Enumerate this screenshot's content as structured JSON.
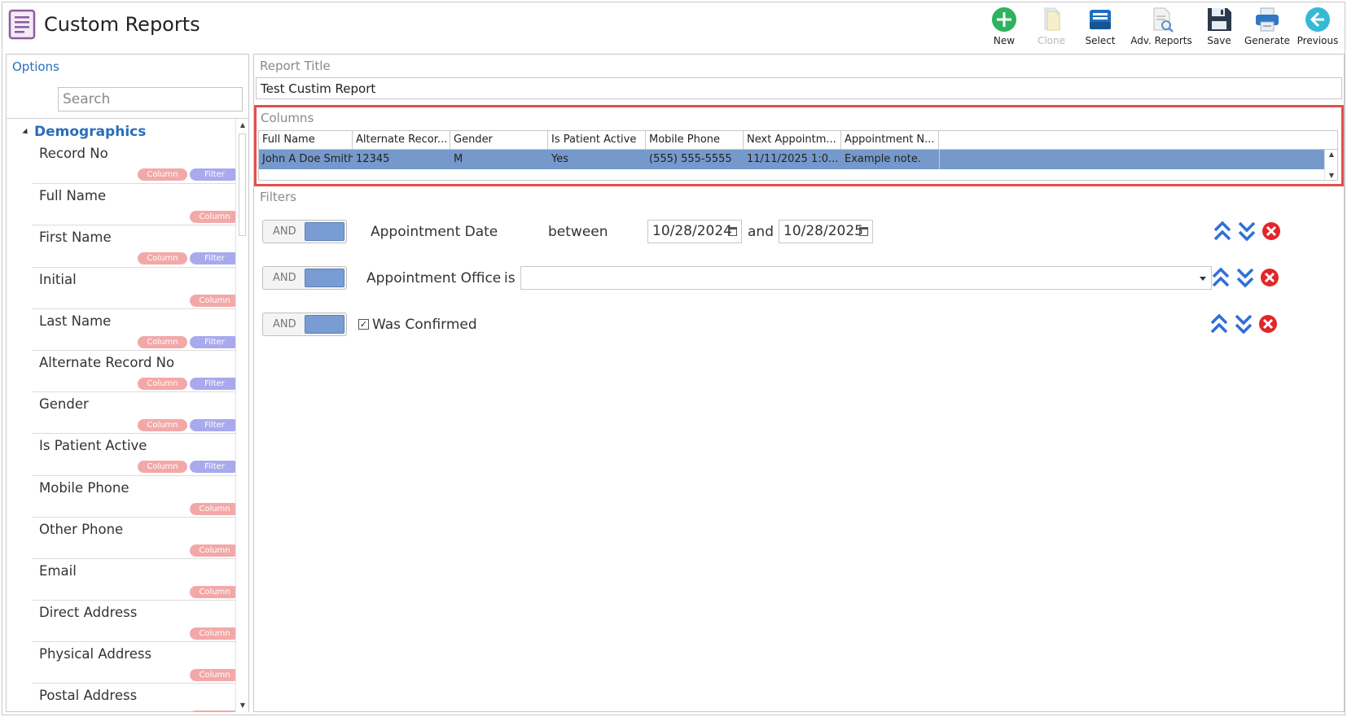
{
  "app": {
    "title": "Custom Reports"
  },
  "toolbar": {
    "new": "New",
    "clone": "Clone",
    "select": "Select",
    "adv_reports": "Adv. Reports",
    "save": "Save",
    "generate": "Generate",
    "previous": "Previous"
  },
  "left": {
    "options_label": "Options",
    "search_placeholder": "Search",
    "group_label": "Demographics",
    "tag_column": "Column",
    "tag_filter": "Filter",
    "items": [
      {
        "label": "Record No",
        "has_filter": true
      },
      {
        "label": "Full Name",
        "has_filter": false
      },
      {
        "label": "First Name",
        "has_filter": true
      },
      {
        "label": "Initial",
        "has_filter": false
      },
      {
        "label": "Last Name",
        "has_filter": true
      },
      {
        "label": "Alternate Record No",
        "has_filter": true
      },
      {
        "label": "Gender",
        "has_filter": true
      },
      {
        "label": "Is Patient Active",
        "has_filter": true
      },
      {
        "label": "Mobile Phone",
        "has_filter": false
      },
      {
        "label": "Other Phone",
        "has_filter": false
      },
      {
        "label": "Email",
        "has_filter": false
      },
      {
        "label": "Direct Address",
        "has_filter": false
      },
      {
        "label": "Physical Address",
        "has_filter": false
      },
      {
        "label": "Postal Address",
        "has_filter": false
      }
    ]
  },
  "report": {
    "title_label": "Report Title",
    "title_value": "Test Custim Report",
    "columns_label": "Columns",
    "filters_label": "Filters"
  },
  "columns_grid": {
    "headers": [
      "Full Name",
      "Alternate Recor...",
      "Gender",
      "Is Patient Active",
      "Mobile Phone",
      "Next Appointm...",
      "Appointment N..."
    ],
    "row": [
      "John A Doe Smith",
      "12345",
      "M",
      "Yes",
      "(555) 555-5555",
      "11/11/2025 1:0...",
      "Example note."
    ]
  },
  "filters": {
    "toggle_label": "AND",
    "appointment_date": {
      "field": "Appointment Date",
      "operator": "between",
      "from": "10/28/2024",
      "connector": "and",
      "to": "10/28/2025"
    },
    "appointment_office": {
      "field": "Appointment Office",
      "operator": "is",
      "value": ""
    },
    "was_confirmed": {
      "field": "Was Confirmed",
      "checked": "✓"
    }
  }
}
